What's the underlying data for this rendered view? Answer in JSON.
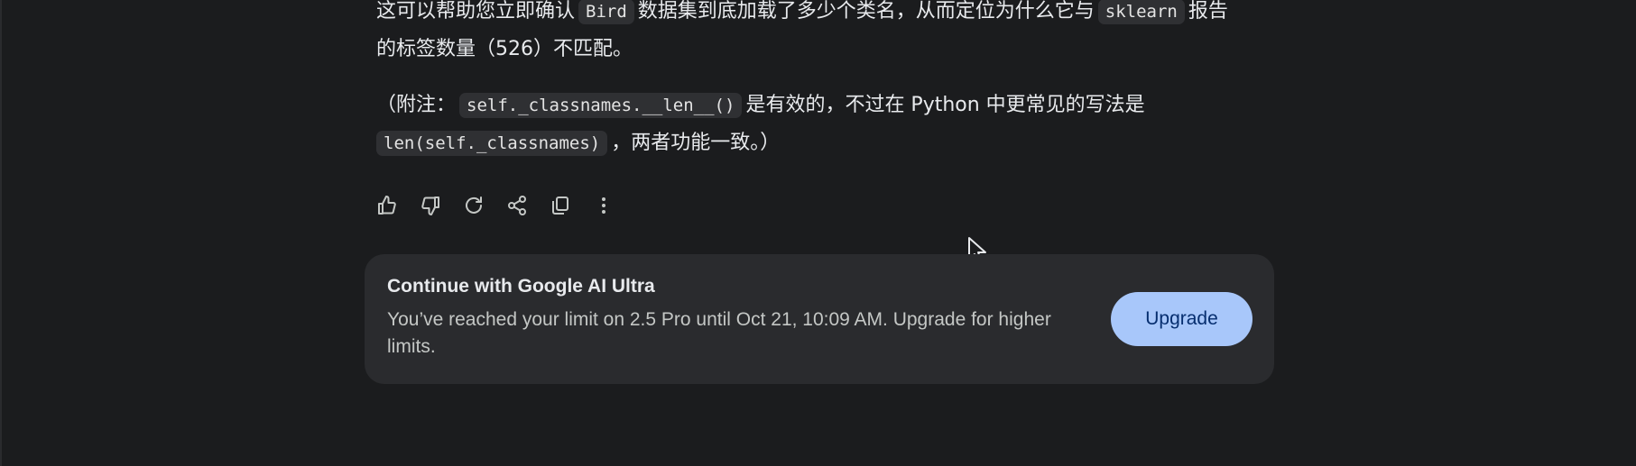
{
  "message": {
    "line1_before": "这可以帮助您立即确认",
    "line1_code1": "Bird",
    "line1_middle": "数据集到底加载了多少个类名，从而定位为什么它与",
    "line1_code2": "sklearn",
    "line1_after": "报告",
    "line2": "的标签数量（526）不匹配。",
    "note_prefix": "（附注：",
    "note_code1": "self._classnames.__len__()",
    "note_middle": "是有效的，不过在 Python 中更常见的写法是",
    "note_code2": "len(self._classnames)",
    "note_suffix": "，两者功能一致。）"
  },
  "actions": {
    "icons": [
      "thumbs-up-icon",
      "thumbs-down-icon",
      "regenerate-icon",
      "share-icon",
      "copy-icon",
      "more-options-icon"
    ]
  },
  "upgrade_card": {
    "title": "Continue with Google AI Ultra",
    "text": "You’ve reached your limit on 2.5 Pro until Oct 21, 10:09 AM. Upgrade for higher limits.",
    "button_label": "Upgrade"
  },
  "colors": {
    "background": "#1b1c1e",
    "card": "#2a2b2e",
    "button": "#a8c7fa",
    "button_text": "#062e6f"
  }
}
